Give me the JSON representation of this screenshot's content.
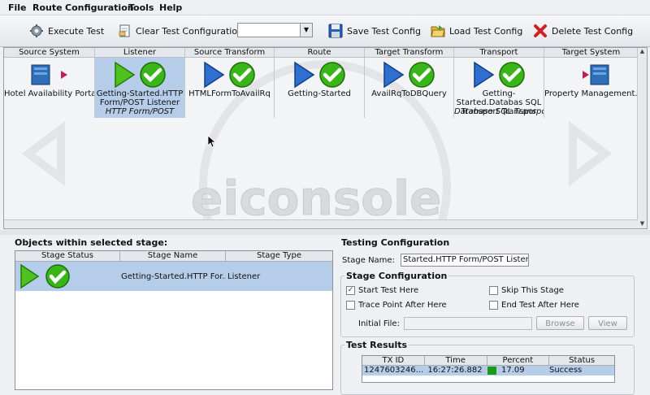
{
  "menu": [
    "File",
    "Route",
    "Configuration",
    "Tools",
    "Help"
  ],
  "toolbar": {
    "execute_test": "Execute Test",
    "clear_config": "Clear Test Configuration",
    "combo_value": "",
    "save_config": "Save Test Config",
    "load_config": "Load Test Config",
    "delete_config": "Delete Test Config"
  },
  "pipeline": {
    "stages": [
      {
        "header": "Source System",
        "name": "Hotel Availability Portal",
        "sub": ""
      },
      {
        "header": "Listener",
        "name": "Getting-Started.HTTP Form/POST Listener",
        "sub": "HTTP Form/POST"
      },
      {
        "header": "Source Transform",
        "name": "HTMLFormToAvailRq",
        "sub": ""
      },
      {
        "header": "Route",
        "name": "Getting-Started",
        "sub": ""
      },
      {
        "header": "Target Transform",
        "name": "AvailRqToDBQuery",
        "sub": ""
      },
      {
        "header": "Transport",
        "name": "Getting-Started.Databas SQL Transport Transpor",
        "sub": "Database SQL Transport"
      },
      {
        "header": "Target System",
        "name": "Property Management...",
        "sub": ""
      }
    ],
    "watermark": "eiconsole"
  },
  "objects": {
    "title": "Objects within selected stage:",
    "columns": [
      "Stage Status",
      "Stage Name",
      "Stage Type"
    ],
    "row": {
      "name": "Getting-Started.HTTP For...",
      "type": "Listener"
    }
  },
  "testing": {
    "title": "Testing Configuration",
    "stage_name_label": "Stage Name:",
    "stage_name_value": "Started.HTTP Form/POST Listener",
    "stage_config_title": "Stage Configuration",
    "checks": [
      {
        "label": "Start Test Here",
        "checked": true
      },
      {
        "label": "Skip This Stage",
        "checked": false
      },
      {
        "label": "Trace Point After Here",
        "checked": false
      },
      {
        "label": "End Test After Here",
        "checked": false
      }
    ],
    "initial_file_label": "Initial File:",
    "browse": "Browse",
    "view": "View",
    "results_title": "Test Results",
    "results_columns": [
      "TX ID",
      "Time",
      "Percent",
      "Status"
    ],
    "results_row": {
      "txid": "1247603246...",
      "time": "16:27:26.882",
      "percent": "17.09",
      "status": "Success"
    },
    "percent_color": "#1a9a1a"
  }
}
